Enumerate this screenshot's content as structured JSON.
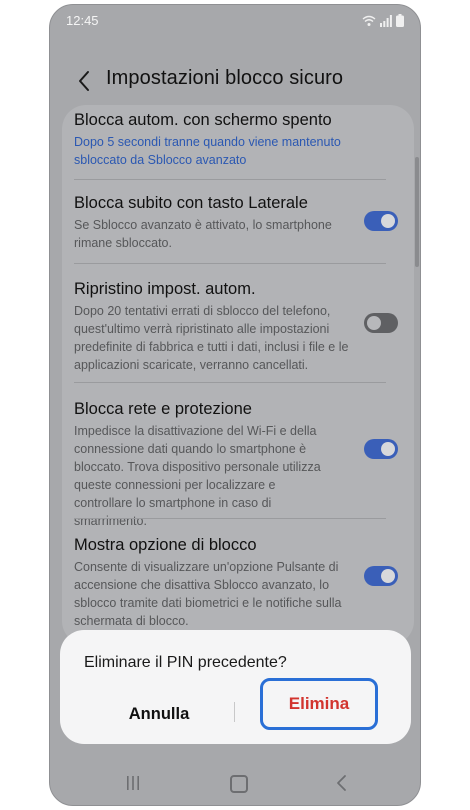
{
  "status_bar": {
    "time": "12:45"
  },
  "header": {
    "title": "Impostazioni blocco sicuro"
  },
  "settings": [
    {
      "title": "Blocca autom. con schermo spento",
      "description": "Dopo 5 secondi tranne quando viene mantenuto sbloccato da Sblocco avanzato",
      "toggle": null
    },
    {
      "title": "Blocca subito con tasto Laterale",
      "description": "Se Sblocco avanzato è attivato, lo smartphone rimane sbloccato.",
      "toggle": "on"
    },
    {
      "title": "Ripristino impost. autom.",
      "description": "Dopo 20 tentativi errati di sblocco del telefono, quest'ultimo verrà ripristinato alle impostazioni predefinite di fabbrica e tutti i dati, inclusi i file e le applicazioni scaricate, verranno cancellati.",
      "toggle": "off"
    },
    {
      "title": "Blocca rete e protezione",
      "description": "Impedisce la disattivazione del Wi-Fi e della connessione dati quando lo smartphone è bloccato. Trova dispositivo personale utilizza queste connessioni per localizzare e controllare lo smartphone in caso di smarrimento.",
      "toggle": "on"
    },
    {
      "title": "Mostra opzione di blocco",
      "description": "Consente di visualizzare un'opzione Pulsante di accensione che disattiva Sblocco avanzato, lo sblocco tramite dati biometrici e le notifiche sulla schermata di blocco.",
      "toggle": "on"
    }
  ],
  "dialog": {
    "message": "Eliminare il PIN precedente?",
    "cancel_label": "Annulla",
    "confirm_label": "Elimina"
  },
  "colors": {
    "accent": "#3a5fb8",
    "link": "#2b58b2",
    "danger": "#d2342e",
    "highlight": "#2a6fd6"
  },
  "icons": [
    "wifi-icon",
    "signal-icon",
    "battery-icon",
    "back-arrow-icon",
    "recent-apps-icon",
    "home-icon",
    "nav-back-icon"
  ]
}
